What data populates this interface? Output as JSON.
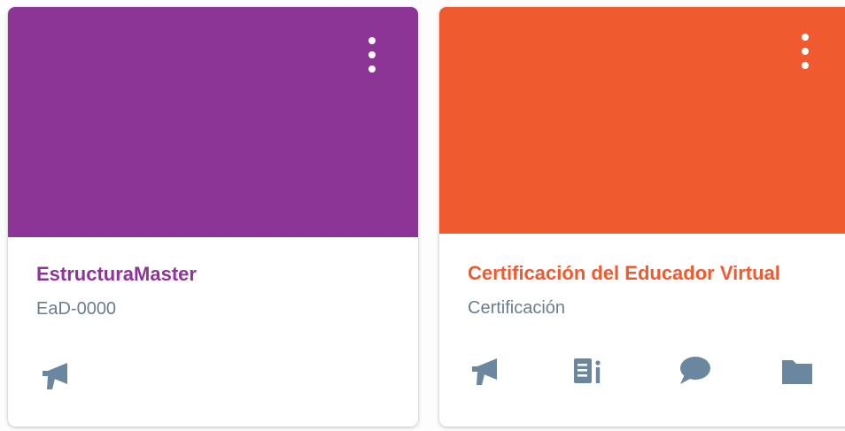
{
  "courses": [
    {
      "title": "EstructuraMaster",
      "code": "EaD-0000",
      "color": "#8d3596",
      "actions": [
        "announcements-icon"
      ]
    },
    {
      "title": "Certificación del Educador Virtual",
      "code": "Certificación",
      "color": "#ef5a2f",
      "actions": [
        "announcements-icon",
        "assignments-icon",
        "discussions-icon",
        "files-icon"
      ]
    }
  ],
  "icon_color": "#6b87a0"
}
